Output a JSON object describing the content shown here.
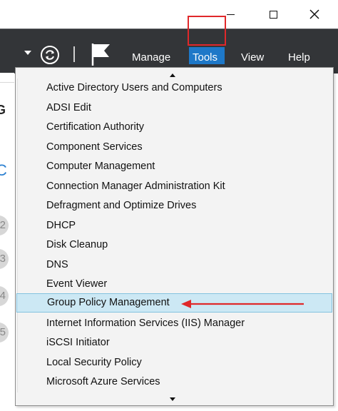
{
  "window": {
    "controls": [
      "minimize",
      "maximize",
      "close"
    ]
  },
  "toolbar": {
    "menus": [
      "Manage",
      "Tools",
      "View",
      "Help"
    ],
    "active_menu": "Tools",
    "icons": [
      "dropdown-caret-icon",
      "refresh-icon",
      "flag-icon"
    ]
  },
  "background_window": {
    "heading_fragment": "G",
    "step_numbers": [
      "2",
      "3",
      "4",
      "5"
    ]
  },
  "tools_menu": {
    "items": [
      "Active Directory Users and Computers",
      "ADSI Edit",
      "Certification Authority",
      "Component Services",
      "Computer Management",
      "Connection Manager Administration Kit",
      "Defragment and Optimize Drives",
      "DHCP",
      "Disk Cleanup",
      "DNS",
      "Event Viewer",
      "Group Policy Management",
      "Internet Information Services (IIS) Manager",
      "iSCSI Initiator",
      "Local Security Policy",
      "Microsoft Azure Services"
    ],
    "highlighted_item": "Group Policy Management"
  },
  "colors": {
    "toolbar_bg": "#333538",
    "tools_active": "#1e78c8",
    "annotation_red": "#e0282a",
    "selection_bg": "#cce8f4"
  }
}
